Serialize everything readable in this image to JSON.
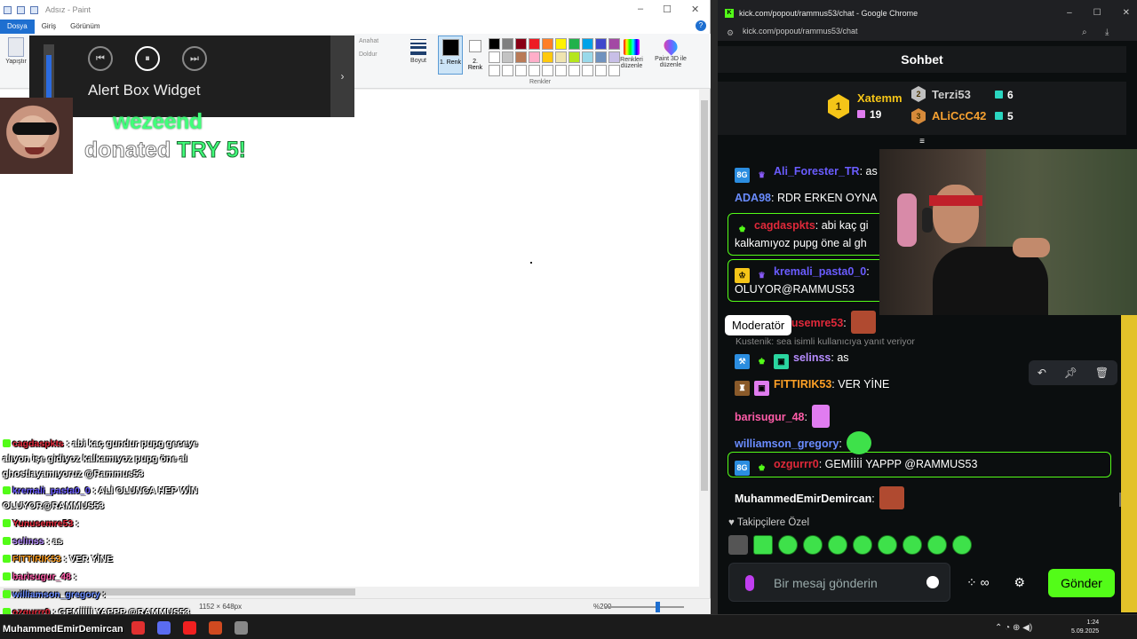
{
  "paint": {
    "title": "Adsız - Paint",
    "tabs": [
      "Dosya",
      "Giriş",
      "Görünüm"
    ],
    "ribbon": {
      "paste": "Yapıştır",
      "outline": "Anahat",
      "fill": "Doldur",
      "size": "Boyut",
      "color1": "1. Renk",
      "color2": "2. Renk",
      "colors_group": "Renkler",
      "edit_colors": "Renkleri düzenle",
      "paint3d": "Paint 3D ile düzenle"
    },
    "palette": [
      "#000000",
      "#7f7f7f",
      "#880015",
      "#ed1c24",
      "#ff7f27",
      "#fff200",
      "#22b14c",
      "#00a2e8",
      "#3f48cc",
      "#a349a4",
      "#ffffff",
      "#c3c3c3",
      "#b97a57",
      "#ffaec9",
      "#ffc90e",
      "#efe4b0",
      "#b5e61d",
      "#99d9ea",
      "#7092be",
      "#c8bfe7",
      "#ffffff",
      "#ffffff",
      "#ffffff",
      "#ffffff",
      "#ffffff",
      "#ffffff",
      "#ffffff",
      "#ffffff",
      "#ffffff",
      "#ffffff"
    ],
    "status": {
      "size": "1152 × 648px",
      "zoom": "%200"
    }
  },
  "alert": {
    "title": "Alert Box Widget",
    "donor": "wezeend",
    "donated_text": "donated",
    "amount": "TRY 5!"
  },
  "overlay_chat": [
    {
      "user": "cagdaspkts",
      "text": ": abi kaç gundur pupg geceye",
      "color": "#e0293a"
    },
    {
      "user": "",
      "text": "alıyon işe gidiyoz kalkamıyoz pupg öne al",
      "color": "#ffffff"
    },
    {
      "user": "",
      "text": "ghostlayamıyoruz @Rammus53",
      "color": "#ffffff"
    },
    {
      "user": "kremali_pasta0_0",
      "text": ": ALİ OLUNCA HEP WİN",
      "color": "#6a5cff"
    },
    {
      "user": "",
      "text": "OLUYOR@RAMMUS53",
      "color": "#ffffff"
    },
    {
      "user": "Yunusemre53",
      "text": ":",
      "color": "#e0293a"
    },
    {
      "user": "selinss",
      "text": ": as",
      "color": "#b68cff"
    },
    {
      "user": "FITTIRIK53",
      "text": ": VER YİNE",
      "color": "#ffa126"
    },
    {
      "user": "barisugur_48",
      "text": ":",
      "color": "#ff5ca8"
    },
    {
      "user": "williamson_gregory",
      "text": ":",
      "color": "#6a8cff"
    },
    {
      "user": "ozgurrr0",
      "text": ": GEMİİİİİ YAPPP @RAMMUS53",
      "color": "#e0293a"
    }
  ],
  "chrome": {
    "title": "kick.com/popout/rammus53/chat - Google Chrome",
    "url": "kick.com/popout/rammus53/chat",
    "chat_title": "Sohbet",
    "leaderboard": [
      {
        "rank": "1",
        "name": "Xatemm",
        "count": "19",
        "color": "#f5c518"
      },
      {
        "rank": "2",
        "name": "Terzi53",
        "count": "6",
        "color": "#c0c0c0"
      },
      {
        "rank": "3",
        "name": "ALiCcC42",
        "count": "5",
        "color": "#d68a3a"
      }
    ],
    "messages": [
      {
        "user": "Ali_Forester_TR",
        "text": ": as",
        "color": "#6a5cff"
      },
      {
        "user": "ADA98",
        "text": ": RDR ERKEN OYNA",
        "color": "#6a8cff"
      },
      {
        "user": "cagdaspkts",
        "text": ": abi kaç gi",
        "text2": "kalkamıyoz pupg öne al gh",
        "color": "#e0293a"
      },
      {
        "user": "kremali_pasta0_0",
        "text": ":",
        "text2": "OLUYOR@RAMMUS53",
        "color": "#6a5cff"
      },
      {
        "user": "Yunusemre53",
        "text": ":",
        "color": "#e0293a"
      },
      {
        "user": "selinss",
        "text": ": as",
        "color": "#b68cff"
      },
      {
        "user": "FITTIRIK53",
        "text": ": VER YİNE",
        "color": "#ffa126"
      },
      {
        "user": "barisugur_48",
        "text": ":",
        "color": "#ff5ca8"
      },
      {
        "user": "williamson_gregory",
        "text": ":",
        "color": "#6a8cff"
      },
      {
        "user": "ozgurrr0",
        "text": ": GEMİİİİ YAPPP @RAMMUS53",
        "color": "#e0293a"
      },
      {
        "user": "MuhammedEmirDemircan",
        "text": ":",
        "color": "#ffffff"
      }
    ],
    "tooltip": "Moderatör",
    "reply_hint": "Kustenik: sea isimli kullanıcıya yanıt veriyor",
    "followers_only": "Takipçilere Özel",
    "input_placeholder": "Bir mesaj gönderin",
    "send": "Gönder",
    "accent": "#53fc18"
  },
  "taskbar": {
    "user_overlay": "MuhammedEmirDemircan",
    "time": "1:24",
    "date": "5.09.2025"
  }
}
